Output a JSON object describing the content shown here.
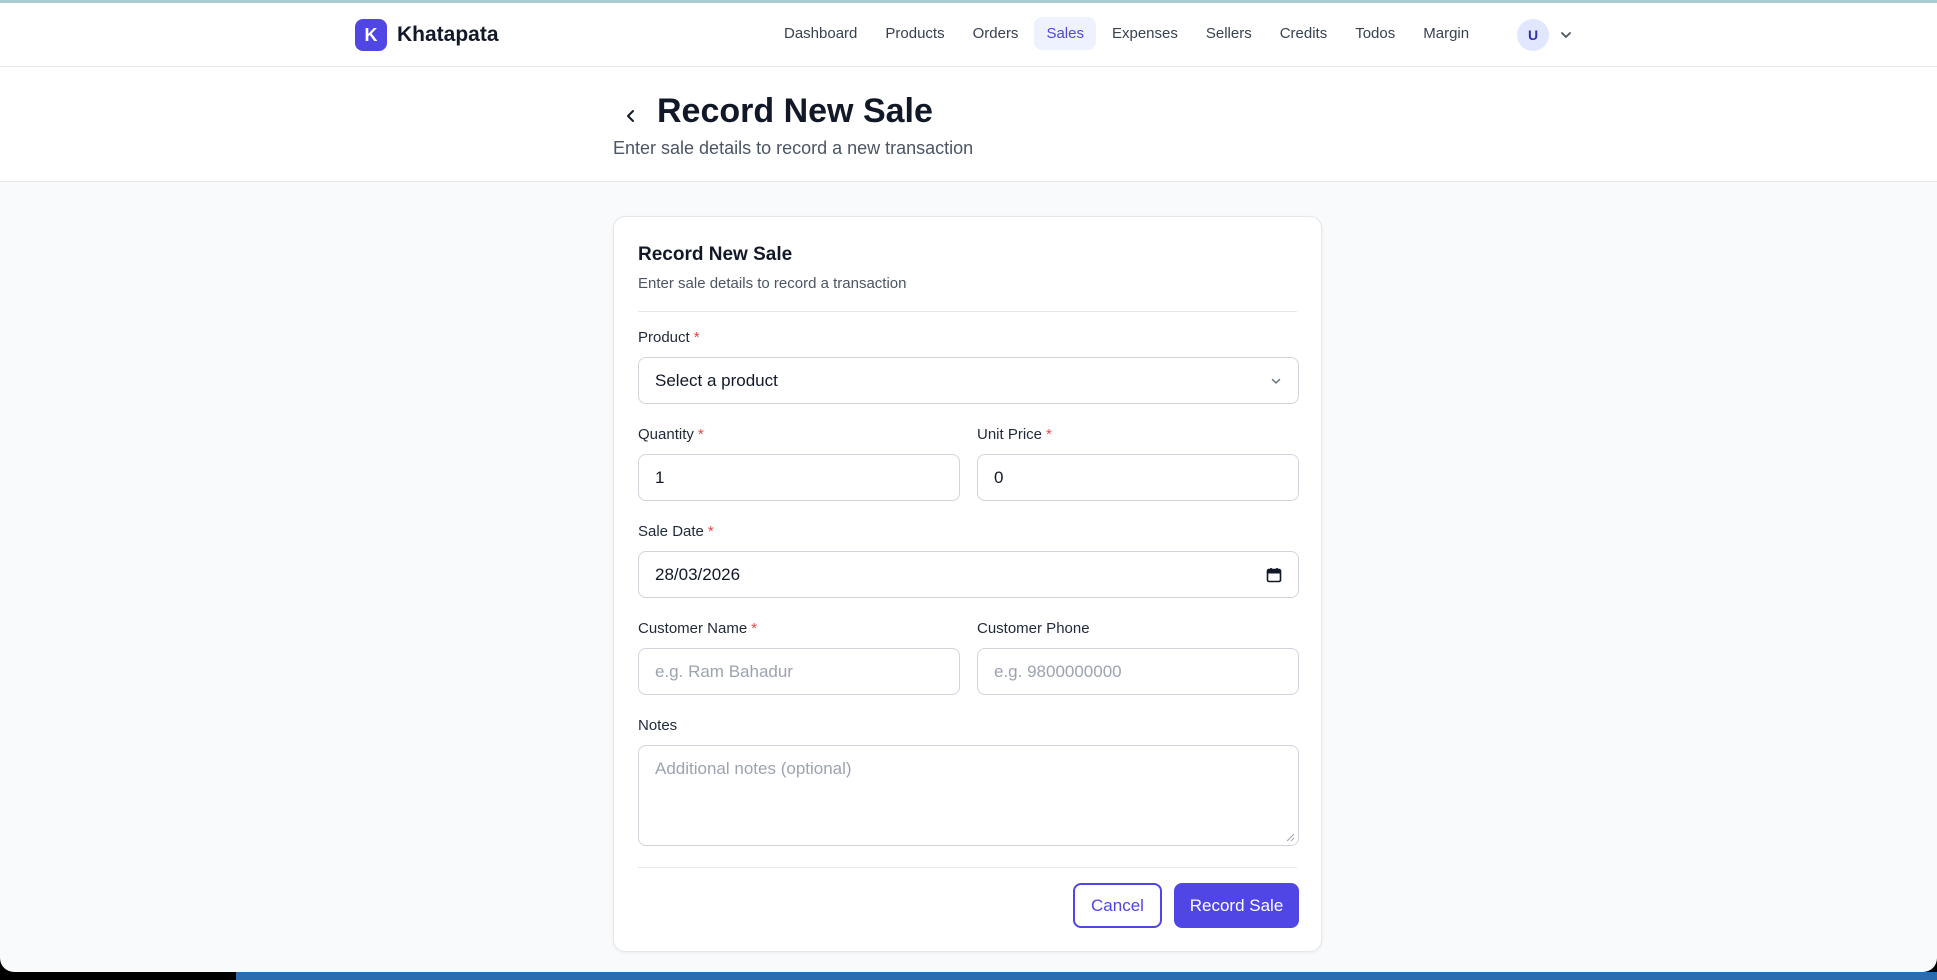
{
  "brand": {
    "logo_letter": "K",
    "name": "Khatapata"
  },
  "nav": {
    "items": [
      {
        "label": "Dashboard",
        "active": false
      },
      {
        "label": "Products",
        "active": false
      },
      {
        "label": "Orders",
        "active": false
      },
      {
        "label": "Sales",
        "active": true
      },
      {
        "label": "Expenses",
        "active": false
      },
      {
        "label": "Sellers",
        "active": false
      },
      {
        "label": "Credits",
        "active": false
      },
      {
        "label": "Todos",
        "active": false
      },
      {
        "label": "Margin",
        "active": false
      }
    ],
    "user_initial": "U"
  },
  "header": {
    "title": "Record New Sale",
    "subtitle": "Enter sale details to record a new transaction"
  },
  "form": {
    "title": "Record New Sale",
    "subtitle": "Enter sale details to record a transaction",
    "required_mark": "*",
    "product": {
      "label": "Product",
      "value": "Select a product"
    },
    "quantity": {
      "label": "Quantity",
      "value": "1"
    },
    "unit_price": {
      "label": "Unit Price",
      "value": "0"
    },
    "sale_date": {
      "label": "Sale Date",
      "value": "28/03/2026"
    },
    "customer_name": {
      "label": "Customer Name",
      "placeholder": "e.g. Ram Bahadur"
    },
    "customer_phone": {
      "label": "Customer Phone",
      "placeholder": "e.g. 9800000000"
    },
    "notes": {
      "label": "Notes",
      "placeholder": "Additional notes (optional)"
    },
    "cancel_label": "Cancel",
    "submit_label": "Record Sale"
  },
  "icons": {
    "back": "chevron-left-icon",
    "select": "chevron-down-icon",
    "date": "calendar-icon",
    "user_menu": "chevron-down-icon"
  },
  "colors": {
    "accent": "#4f46e5",
    "accent_light": "#eef2ff",
    "required": "#ef4444",
    "background": "#f9fafb"
  }
}
